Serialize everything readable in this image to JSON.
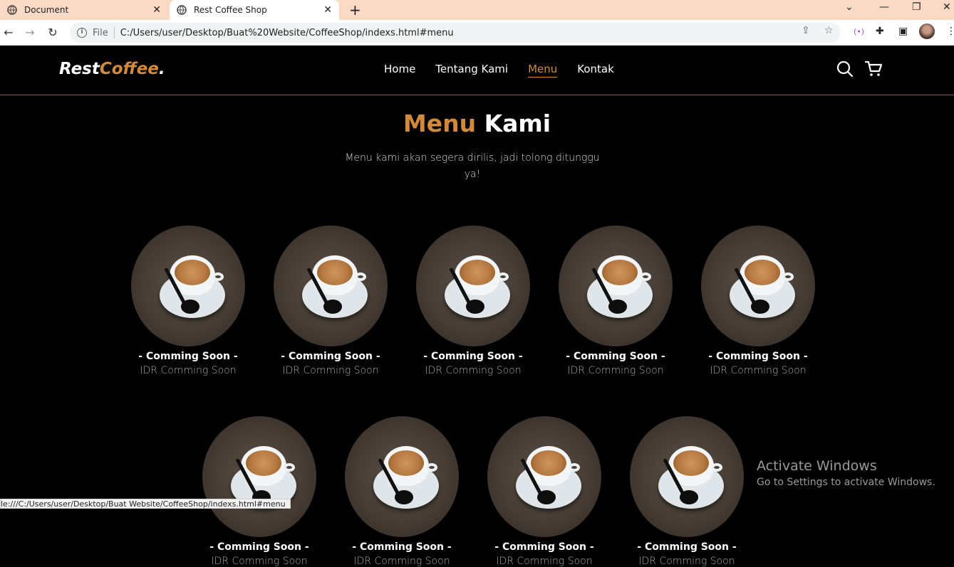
{
  "browser": {
    "tabs": [
      {
        "title": "Document",
        "active": false
      },
      {
        "title": "Rest Coffee Shop",
        "active": true
      }
    ],
    "address": {
      "scheme_label": "File",
      "url": "C:/Users/user/Desktop/Buat%20Website/CoffeeShop/indexs.html#menu"
    },
    "status_url": "le:///C:/Users/user/Desktop/Buat Website/CoffeeShop/indexs.html#menu",
    "colors": {
      "tabbar": "#fad9c5"
    }
  },
  "site": {
    "logo": {
      "part1": "Rest",
      "part2": "Coffee",
      "dot": "."
    },
    "nav": [
      {
        "label": "Home",
        "active": false
      },
      {
        "label": "Tentang Kami",
        "active": false
      },
      {
        "label": "Menu",
        "active": true
      },
      {
        "label": "Kontak",
        "active": false
      }
    ],
    "icons": [
      "search-icon",
      "cart-icon"
    ],
    "accent_color": "#d18a3c"
  },
  "menu_section": {
    "title_accent": "Menu",
    "title_rest": "Kami",
    "description": "Menu kami akan segera dirilis, jadi tolong ditunggu ya!",
    "items": [
      {
        "name": "- Comming Soon -",
        "price": "IDR Comming Soon"
      },
      {
        "name": "- Comming Soon -",
        "price": "IDR Comming Soon"
      },
      {
        "name": "- Comming Soon -",
        "price": "IDR Comming Soon"
      },
      {
        "name": "- Comming Soon -",
        "price": "IDR Comming Soon"
      },
      {
        "name": "- Comming Soon -",
        "price": "IDR Comming Soon"
      },
      {
        "name": "- Comming Soon -",
        "price": "IDR Comming Soon"
      },
      {
        "name": "- Comming Soon -",
        "price": "IDR Comming Soon"
      },
      {
        "name": "- Comming Soon -",
        "price": "IDR Comming Soon"
      },
      {
        "name": "- Comming Soon -",
        "price": "IDR Comming Soon"
      }
    ]
  },
  "os_watermark": {
    "line1": "Activate Windows",
    "line2": "Go to Settings to activate Windows."
  }
}
